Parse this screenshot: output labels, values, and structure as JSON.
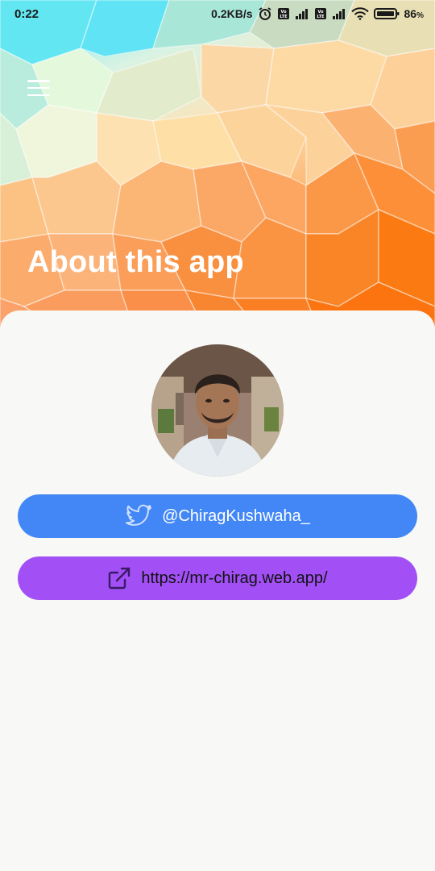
{
  "status_bar": {
    "time": "0:22",
    "speed": "0.2KB/s",
    "battery": "86",
    "battery_unit": "%",
    "icons": [
      "alarm-icon",
      "volte-icon",
      "signal-icon",
      "volte-icon",
      "signal-icon",
      "wifi-icon",
      "battery-icon"
    ]
  },
  "header": {
    "menu_icon": "hamburger-menu-icon",
    "title": "About this app",
    "colors": {
      "top": "#5be8f0",
      "middle": "#fcbd7d",
      "bottom": "#ff7a14"
    }
  },
  "profile": {
    "avatar": "profile-photo"
  },
  "links": {
    "twitter": {
      "icon": "twitter-bird-icon",
      "label": "@ChiragKushwaha_",
      "color": "#4287f5"
    },
    "website": {
      "icon": "external-link-icon",
      "label": "https://mr-chirag.web.app/",
      "color": "#a250f5"
    }
  }
}
